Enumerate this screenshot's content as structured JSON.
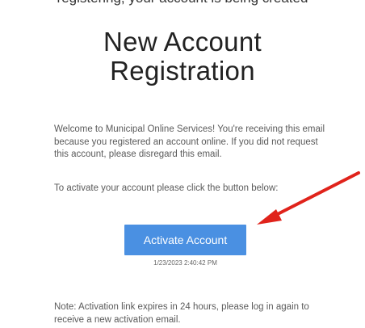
{
  "header_clip": "registering, your account is being created",
  "email": {
    "title_line1": "New Account",
    "title_line2": "Registration",
    "intro": "Welcome to Municipal Online Services! You're receiving this email because you registered an account online. If you did not request this account, please disregard this email.",
    "instruction": "To activate your account please click the button below:",
    "button_label": "Activate Account",
    "timestamp": "1/23/2023 2:40:42 PM",
    "note": "Note: Activation link expires in 24 hours, please log in again to receive a new activation email."
  },
  "colors": {
    "button": "#4a90e2",
    "arrow": "#e0231b"
  },
  "icons": {
    "arrow": "red-arrow-icon"
  }
}
